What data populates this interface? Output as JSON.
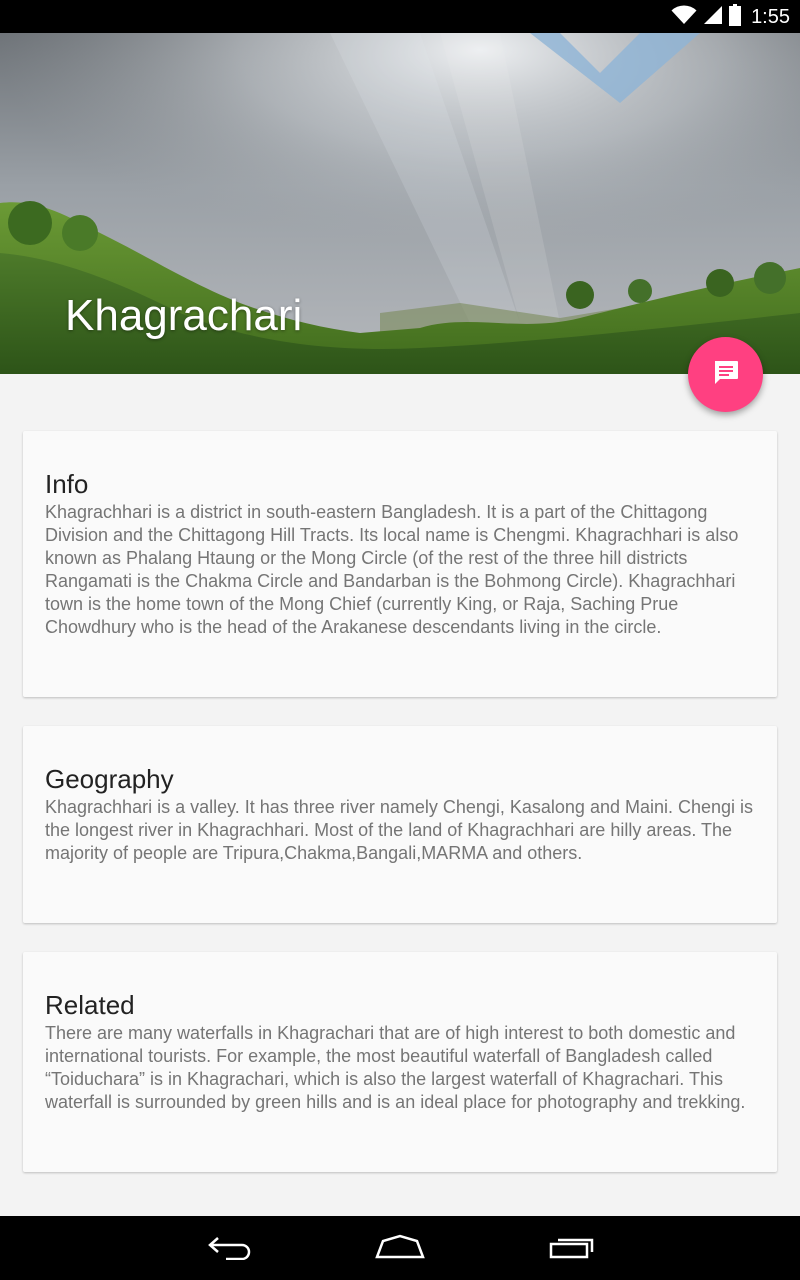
{
  "status_bar": {
    "time": "1:55",
    "wifi_icon": "wifi-icon",
    "signal_icon": "signal-icon",
    "battery_icon": "battery-icon"
  },
  "header": {
    "title": "Khagrachari"
  },
  "fab": {
    "icon": "message-icon",
    "color": "#ff4081"
  },
  "cards": [
    {
      "title": "Info",
      "body": "Khagrachhari is a district in south-eastern Bangladesh. It is a part of the Chittagong Division and the Chittagong Hill Tracts. Its local name is Chengmi. Khagrachhari is also known as Phalang Htaung or the Mong Circle (of the rest of the three hill districts Rangamati is the Chakma Circle and Bandarban is the Bohmong Circle). Khagrachhari town is the home town of the Mong Chief (currently King, or Raja, Saching Prue Chowdhury who is the head of the Arakanese descendants living in the circle."
    },
    {
      "title": "Geography",
      "body": "Khagrachhari is a valley. It has three river namely Chengi, Kasalong and Maini. Chengi is the longest river in Khagrachhari. Most of the land of Khagrachhari are hilly areas. The majority of people are Tripura,Chakma,Bangali,MARMA and others."
    },
    {
      "title": "Related",
      "body": "There are many waterfalls in Khagrachari that are of high interest to both domestic and international tourists. For example, the most beautiful waterfall of Bangladesh called “Toiduchara” is in Khagrachari, which is also the largest waterfall of Khagrachari. This waterfall is surrounded by green hills and is an ideal place for photography and trekking."
    }
  ],
  "nav_bar": {
    "back_icon": "back-icon",
    "home_icon": "home-icon",
    "recents_icon": "recents-icon"
  }
}
